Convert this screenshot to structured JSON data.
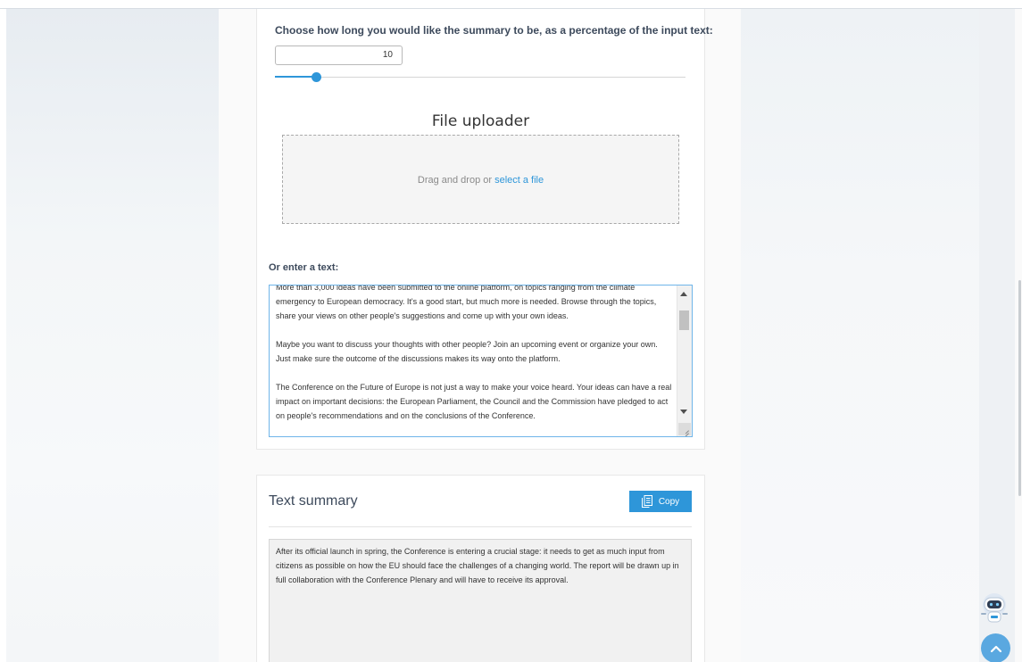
{
  "summary_length": {
    "label": "Choose how long you would like the summary to be, as a percentage of the input text:",
    "value": "10",
    "slider_percent": 10
  },
  "uploader": {
    "title": "File uploader",
    "drop_text": "Drag and drop or ",
    "select_link": "select a file"
  },
  "text_input": {
    "label": "Or enter a text:",
    "paragraphs": [
      "More than 3,000 ideas have been submitted to the online platform, on topics ranging from the climate emergency to European democracy. It's a good start, but much more is needed. Browse through the topics, share your views on other people's suggestions and come up with your own ideas.",
      "Maybe you want to discuss your thoughts with other people? Join an upcoming event or organize your own. Just make sure the outcome of the discussions makes its way onto the platform.",
      "The Conference on the Future of Europe is not just a way to make your voice heard. Your ideas can have a real impact on important decisions: the European Parliament, the Council and the Commission have pledged to act on people's recommendations and on the conclusions of the Conference."
    ]
  },
  "summary": {
    "title": "Text summary",
    "copy_label": "Copy",
    "text": "After its official launch in spring, the Conference is entering a crucial stage: it needs to get as much input from citizens as possible on how the EU should face the challenges of a changing world. The report will be drawn up in full collaboration with the Conference Plenary and will have to receive its approval."
  },
  "widgets": {
    "chatbot": "robot-icon",
    "back_to_top": "chevron-up-icon"
  },
  "colors": {
    "accent": "#2e96d9",
    "heading": "#3d4a5c"
  }
}
